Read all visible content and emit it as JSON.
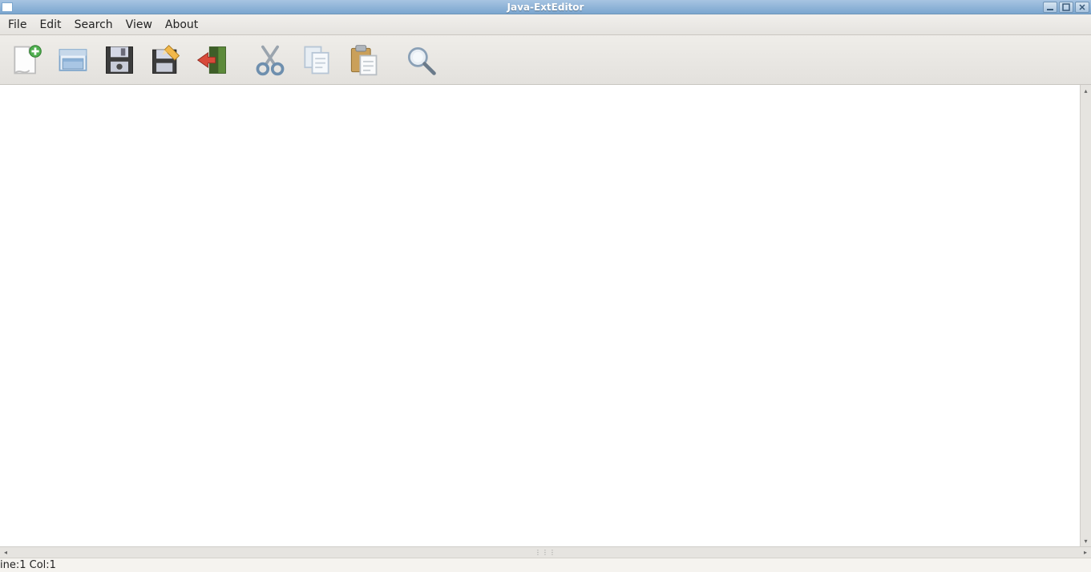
{
  "window": {
    "title": "Java-ExtEditor"
  },
  "menu": {
    "items": [
      "File",
      "Edit",
      "Search",
      "View",
      "About"
    ]
  },
  "toolbar": {
    "buttons": [
      {
        "name": "new-file-icon"
      },
      {
        "name": "open-folder-icon"
      },
      {
        "name": "save-icon"
      },
      {
        "name": "save-as-icon"
      },
      {
        "name": "exit-icon"
      },
      {
        "name": "cut-icon"
      },
      {
        "name": "copy-icon"
      },
      {
        "name": "paste-icon"
      },
      {
        "name": "search-icon"
      }
    ]
  },
  "editor": {
    "content": ""
  },
  "status": {
    "line_col": "ine:1 Col:1"
  }
}
